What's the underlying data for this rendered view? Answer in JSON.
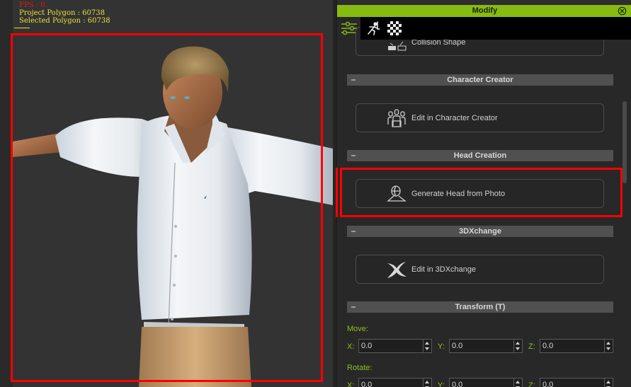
{
  "viewport": {
    "stats": {
      "fps": "FPS : 0.",
      "project_polygon": "Project Polygon : 60738",
      "selected_polygon": "Selected Polygon : 60738"
    },
    "highlight_color": "#ff0000"
  },
  "panel": {
    "title": "Modify",
    "accent_color": "#86bb11",
    "tabs": [
      {
        "icon": "sliders-icon",
        "active": true
      },
      {
        "icon": "motion-pose-icon",
        "active": false
      },
      {
        "icon": "checker-material-icon",
        "active": false
      }
    ],
    "partial_button": {
      "label": "Collision Shape",
      "icon": "collision-shape-icon"
    },
    "sections": [
      {
        "title": "Character Creator",
        "button": {
          "label": "Edit in Character Creator",
          "icon": "character-creator-icon"
        }
      },
      {
        "title": "Head Creation",
        "button": {
          "label": "Generate Head from Photo",
          "icon": "head-photo-icon"
        }
      },
      {
        "title": "3DXchange",
        "button": {
          "label": "Edit in 3DXchange",
          "icon": "3dxchange-icon"
        }
      },
      {
        "title": "Transform  (T)"
      }
    ],
    "transform": {
      "move": {
        "label": "Move:",
        "x_label": "X:",
        "y_label": "Y:",
        "z_label": "Z:",
        "x": "0.0",
        "y": "0.0",
        "z": "0.0"
      },
      "rotate": {
        "label": "Rotate:",
        "x_label": "X:",
        "y_label": "Y:",
        "z_label": "Z:",
        "x": "0.0",
        "y": "0.0",
        "z": "0.0"
      }
    }
  }
}
